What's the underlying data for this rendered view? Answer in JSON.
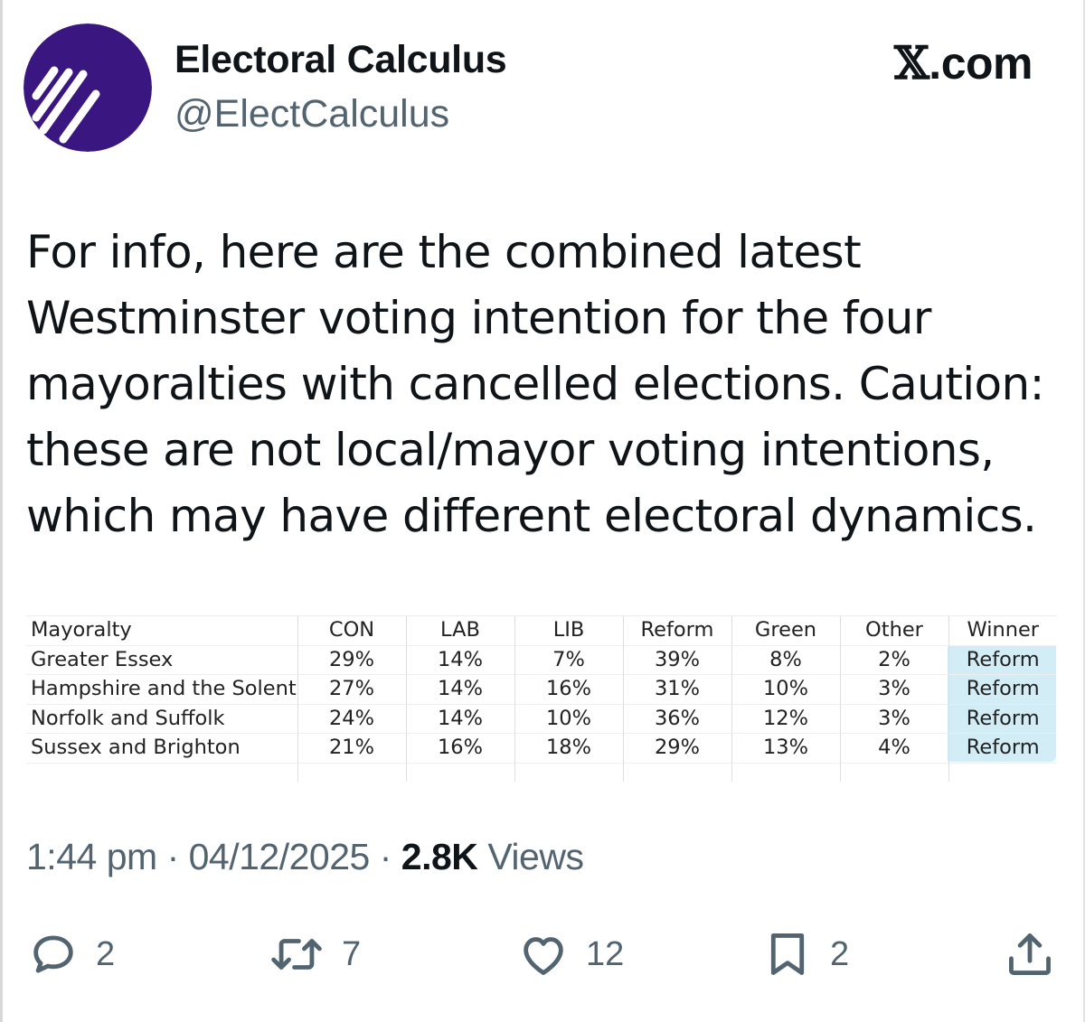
{
  "author": {
    "display_name": "Electoral Calculus",
    "handle": "@ElectCalculus",
    "avatar_icon": "electoral-calculus-logo",
    "avatar_color": "#3a1780"
  },
  "source": {
    "glyph": "𝕏",
    "label": ".com"
  },
  "tweet": {
    "text_lines": [
      "For info, here are the combined latest",
      "Westminster voting intention for the four",
      "mayoralties with cancelled elections. Caution:",
      "these are not local/mayor voting intentions,",
      "which may have different electoral dynamics."
    ]
  },
  "table": {
    "headers": [
      "Mayoralty",
      "CON",
      "LAB",
      "LIB",
      "Reform",
      "Green",
      "Other",
      "Winner"
    ],
    "rows": [
      [
        "Greater Essex",
        "29%",
        "14%",
        "7%",
        "39%",
        "8%",
        "2%",
        "Reform"
      ],
      [
        "Hampshire and the Solent",
        "27%",
        "14%",
        "16%",
        "31%",
        "10%",
        "3%",
        "Reform"
      ],
      [
        "Norfolk and Suffolk",
        "24%",
        "14%",
        "10%",
        "36%",
        "12%",
        "3%",
        "Reform"
      ],
      [
        "Sussex and Brighton",
        "21%",
        "16%",
        "18%",
        "29%",
        "13%",
        "4%",
        "Reform"
      ]
    ],
    "winner_highlight_color": "#d2edf6"
  },
  "meta": {
    "time": "1:44 pm",
    "separator": "·",
    "date": "04/12/2025",
    "views_count": "2.8K",
    "views_label": "Views"
  },
  "actions": {
    "replies": "2",
    "reposts": "7",
    "likes": "12",
    "bookmarks": "2"
  }
}
